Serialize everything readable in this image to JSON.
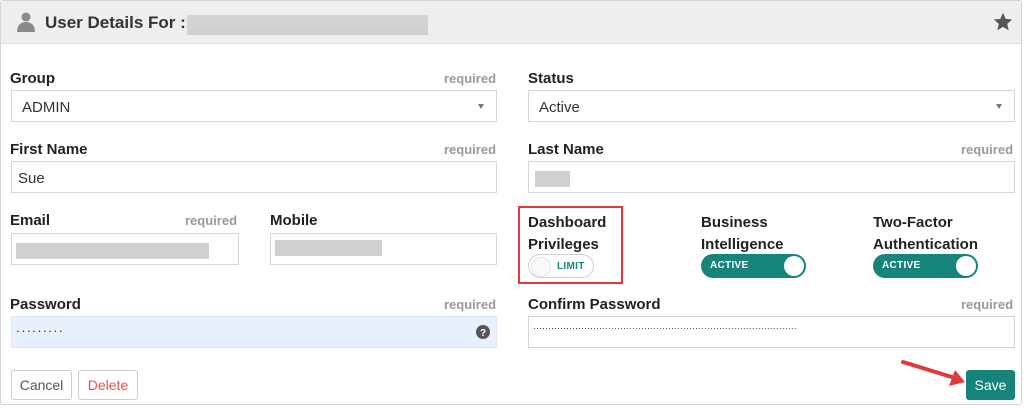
{
  "header": {
    "title": "User Details For :",
    "user_icon": "user-icon",
    "star_icon": "star-icon"
  },
  "form": {
    "group": {
      "label": "Group",
      "required": "required",
      "value": "ADMIN"
    },
    "status": {
      "label": "Status",
      "value": "Active"
    },
    "first_name": {
      "label": "First Name",
      "required": "required",
      "value": "Sue"
    },
    "last_name": {
      "label": "Last Name",
      "required": "required"
    },
    "email": {
      "label": "Email",
      "required": "required"
    },
    "mobile": {
      "label": "Mobile"
    },
    "dashboard_privileges": {
      "label_line1": "Dashboard",
      "label_line2": "Privileges",
      "toggle_label": "LIMIT",
      "state": "off"
    },
    "business_intelligence": {
      "label_line1": "Business",
      "label_line2": "Intelligence",
      "toggle_label": "ACTIVE",
      "state": "on"
    },
    "two_factor": {
      "label_line1": "Two-Factor",
      "label_line2": "Authentication",
      "toggle_label": "ACTIVE",
      "state": "on"
    },
    "password": {
      "label": "Password",
      "required": "required",
      "value": "·········"
    },
    "confirm_password": {
      "label": "Confirm Password",
      "required": "required",
      "value": "························································································"
    }
  },
  "actions": {
    "cancel_label": "Cancel",
    "delete_label": "Delete",
    "save_label": "Save"
  },
  "colors": {
    "accent": "#17847b",
    "delete": "#e05555",
    "highlight": "#e03a3a",
    "password_bg": "#e8f0fe"
  }
}
